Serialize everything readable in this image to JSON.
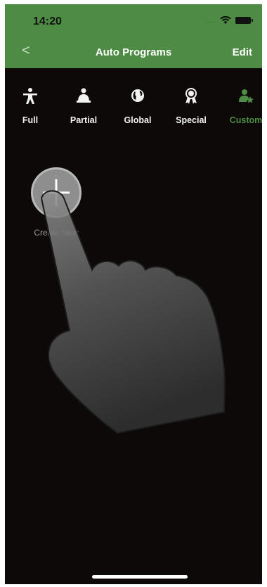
{
  "status_bar": {
    "time": "14:20",
    "signal_text": "....",
    "icons": [
      "wifi-icon",
      "battery-icon"
    ]
  },
  "nav": {
    "back_icon": "chevron-left-icon",
    "back_glyph": "<",
    "title": "Auto Programs",
    "edit_label": "Edit"
  },
  "categories": [
    {
      "label": "Full",
      "icon": "full-body-icon",
      "active": false
    },
    {
      "label": "Partial",
      "icon": "partial-body-icon",
      "active": false
    },
    {
      "label": "Global",
      "icon": "globe-icon",
      "active": false
    },
    {
      "label": "Special",
      "icon": "award-icon",
      "active": false
    },
    {
      "label": "Custom",
      "icon": "custom-user-icon",
      "active": true
    }
  ],
  "create_new": {
    "label": "Create New",
    "icon": "plus-icon"
  },
  "overlay": {
    "icon": "tap-hand-icon"
  },
  "colors": {
    "header_green": "#4e8c45",
    "background": "#0d0909",
    "active_green": "#4e8c45"
  }
}
